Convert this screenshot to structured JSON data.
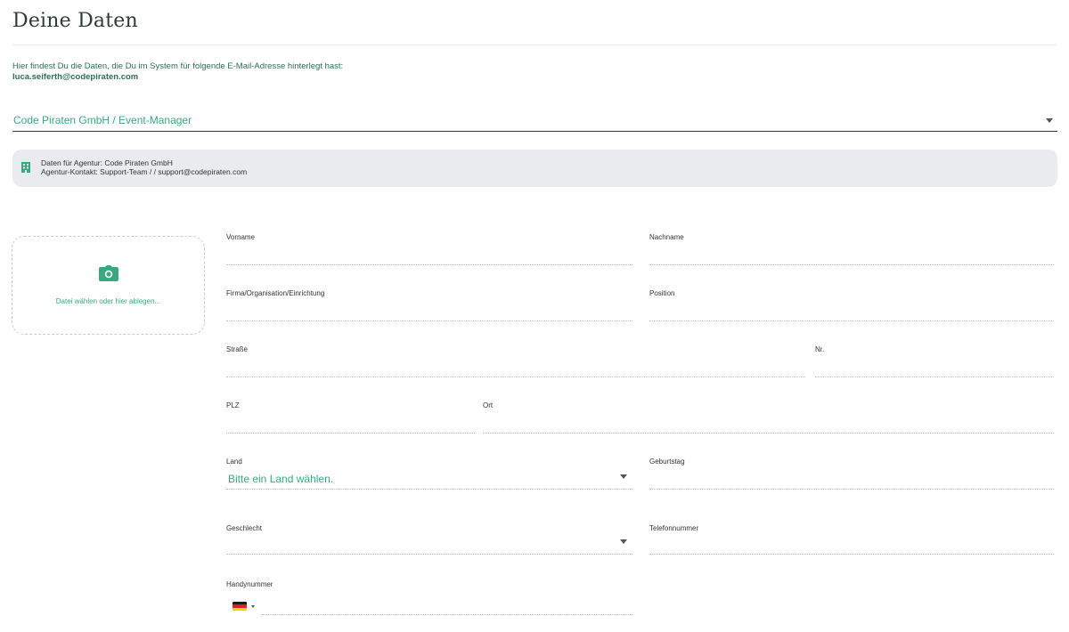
{
  "page": {
    "title": "Deine Daten",
    "intro_text": "Hier findest Du die Daten, die Du im System für folgende E-Mail-Adresse hinterlegt hast:",
    "email": "luca.seiferth@codepiraten.com"
  },
  "role_select": {
    "value": "Code Piraten GmbH / Event-Manager"
  },
  "agency": {
    "icon": "building-icon",
    "line1": "Daten für Agentur: Code Piraten GmbH",
    "line2": "Agentur-Kontakt: Support-Team / / support@codepiraten.com"
  },
  "upload": {
    "icon": "camera-icon",
    "label": "Datei wählen oder hier ablegen..."
  },
  "form": {
    "vorname": {
      "label": "Vorname",
      "value": ""
    },
    "nachname": {
      "label": "Nachname",
      "value": ""
    },
    "firma": {
      "label": "Firma/Organisation/Einrichtung",
      "value": ""
    },
    "position": {
      "label": "Position",
      "value": ""
    },
    "strasse": {
      "label": "Straße",
      "value": ""
    },
    "nr": {
      "label": "Nr.",
      "value": ""
    },
    "plz": {
      "label": "PLZ",
      "value": ""
    },
    "ort": {
      "label": "Ort",
      "value": ""
    },
    "land": {
      "label": "Land",
      "placeholder": "Bitte ein Land wählen."
    },
    "geburtstag": {
      "label": "Geburtstag",
      "value": ""
    },
    "geschlecht": {
      "label": "Geschlecht",
      "value": ""
    },
    "telefon": {
      "label": "Telefonnummer",
      "value": ""
    },
    "handy": {
      "label": "Handynummer",
      "value": "",
      "country_flag": "germany-flag-icon"
    }
  },
  "colors": {
    "accent": "#3aa87e",
    "accent_dark": "#2f6e57",
    "info_bg": "#e9ebee"
  }
}
